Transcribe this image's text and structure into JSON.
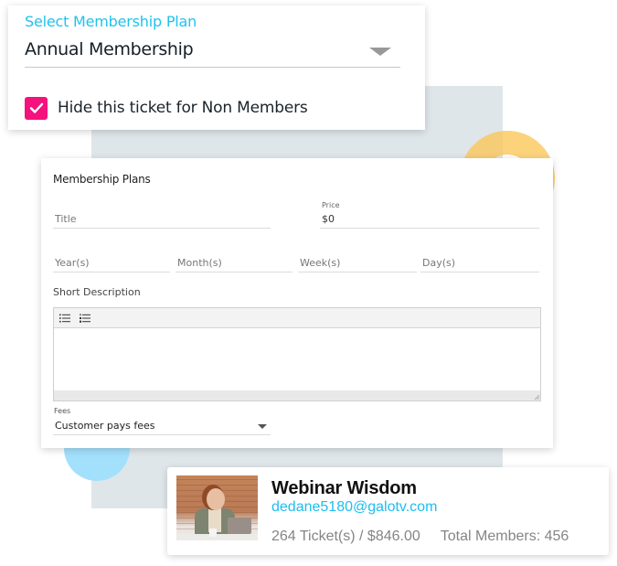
{
  "membership_select": {
    "label": "Select Membership Plan",
    "value": "Annual Membership",
    "hide_checkbox": {
      "label": "Hide this ticket for Non Members",
      "checked": true
    }
  },
  "membership_form": {
    "title": "Membership Plans",
    "fields": {
      "title_placeholder": "Title",
      "price_label": "Price",
      "price_value": "$0",
      "years_placeholder": "Year(s)",
      "months_placeholder": "Month(s)",
      "weeks_placeholder": "Week(s)",
      "days_placeholder": "Day(s)"
    },
    "short_description": {
      "label": "Short Description",
      "toolbar": [
        "bulleted-list-icon",
        "numbered-list-icon"
      ],
      "value": ""
    },
    "fees": {
      "label": "Fees",
      "value": "Customer pays fees"
    }
  },
  "event_card": {
    "title": "Webinar Wisdom",
    "email": "dedane5180@galotv.com",
    "tickets": "264 Ticket(s) / $846.00",
    "members": "Total Members: 456"
  },
  "colors": {
    "accent_cyan": "#1fc3ee",
    "checkbox_pink": "#f5127e",
    "ring_yellow": "#fbc75a",
    "circle_blue": "#a3e0fb",
    "bg_square": "#dfe6ea"
  }
}
